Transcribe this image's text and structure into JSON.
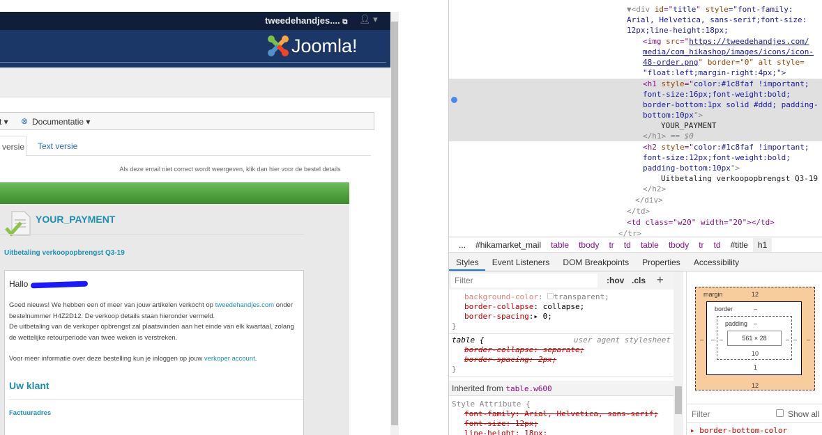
{
  "admin": {
    "site_link": "tweedehandjes....",
    "logo_text": "Joomla!",
    "toolbar": {
      "partial_item": "t",
      "documentation": "Documentatie"
    },
    "tabs": [
      {
        "label": "versie"
      },
      {
        "label": "Text versie"
      }
    ],
    "notice": "Als deze email niet correct wordt weergeven, klik dan hier voor de bestel details"
  },
  "email": {
    "title": "YOUR_PAYMENT",
    "subtitle": "Uitbetaling verkoopopbrengst Q3-19",
    "greeting": "Hallo",
    "p1_a": "Goed nieuws! We hebben een of meer van jouw artikelen verkocht op ",
    "p1_link": "tweedehandjes.com",
    "p1_b": " onder bestelnummer H4Z2D12. De verkoop details staan hieronder vermeld.",
    "p2": "De uitbetaling van de verkoper opbrengst zal plaatsvinden aan het einde van elk kwartaal, zolang de wettelijke retourperiode van twee weken is verstreken.",
    "p3_a": "Voor meer informatie over deze bestelling kun je inloggen op jouw ",
    "p3_link": "verkoper account",
    "p3_b": ".",
    "section": "Uw klant",
    "billing": "Factuuradres"
  },
  "devtools": {
    "dom_lines": {
      "l1a": "▼<div ",
      "l1b": "id",
      "l1c": "=\"",
      "l1d": "title",
      "l1e": "\" ",
      "l1f": "style",
      "l1g": "=\"font-family:",
      "l2": "Arial, Helvetica, sans-serif;font-size:",
      "l3": "12px;line-height:18px;",
      "img_url1": "https://tweedehandjes.com/",
      "img_url2": "media/com_hikashop/images/icons/icon-",
      "img_url3": "48-order.png",
      "img_rest": "\" border=\"0\" alt style=",
      "img_style": "\"float:left;margin-right:4px;\">",
      "h1_1": "color:#1c8faf !important;",
      "h1_2": "font-size:16px;font-weight:bold;",
      "h1_3": "border-bottom:1px solid #ddd; padding-",
      "h1_4": "bottom:10px",
      "h1_text": "YOUR_PAYMENT",
      "h1_close": "</h1>",
      "h1_eq": " == $0",
      "h2_1": "color:#1c8faf !important;",
      "h2_2": "font-size:12px;font-weight:bold;",
      "h2_3": "padding-bottom:10px",
      "h2_text": "Uitbetaling verkoopopbrengst Q3-19",
      "h2_close": "</h2>",
      "div_close": "</div>",
      "td_close": "</td>",
      "td_w20": "<td class=\"w20\" width=\"20\"></td>",
      "tr_close": "</tr>"
    },
    "breadcrumbs": [
      "...",
      "#hikamarket_mail",
      "table",
      "tbody",
      "tr",
      "td",
      "table",
      "tbody",
      "tr",
      "td",
      "#title",
      "h1"
    ],
    "tabs": [
      "Styles",
      "Event Listeners",
      "DOM Breakpoints",
      "Properties",
      "Accessibility"
    ],
    "filter_placeholder": "Filter",
    "hov": ":hov",
    "cls": ".cls",
    "plus": "+",
    "styles": {
      "bg_prop": "background-color",
      "bg_val": "transparent;",
      "bc_prop": "border-collapse",
      "bc_val": "collapse;",
      "bs_prop": "border-spacing",
      "bs_val": "0;",
      "ua_selector": "table {",
      "ua_source": "user agent stylesheet",
      "ua_bc": "border-collapse: separate;",
      "ua_bs": "border-spacing: 2px;",
      "inherited_label": "Inherited from ",
      "inherited_from": "table.w600",
      "style_attr": "Style Attribute {",
      "sa_ff": "font-family: Arial, Helvetica, sans-serif;",
      "sa_fs": "font-size: 12px;",
      "sa_lh": "line-height: 18px;"
    },
    "box_model": {
      "margin_label": "margin",
      "margin_top": "12",
      "margin_bottom": "12",
      "border_label": "border",
      "border_top": "–",
      "border_bottom": "1",
      "padding_label": "padding",
      "padding_top": "–",
      "padding_bottom": "10",
      "content": "561 × 28",
      "dash": "–"
    },
    "computed_filter": "Filter",
    "show_all": "Show all",
    "computed_first": "border-bottom-color"
  }
}
